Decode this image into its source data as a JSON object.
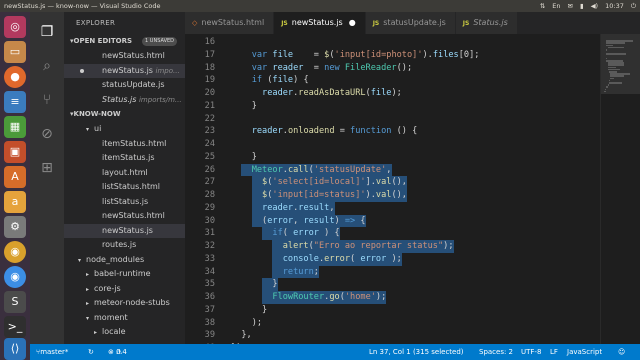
{
  "window": {
    "title": "newStatus.js — know-now — Visual Studio Code"
  },
  "tray": {
    "keyboard": "En",
    "time": "10:37"
  },
  "launcher": [
    "files-icon",
    "firefox-icon",
    "libreoffice-writer-icon",
    "libreoffice-calc-icon",
    "libreoffice-impress-icon",
    "software-center-icon",
    "amazon-icon",
    "settings-icon",
    "chrome-icon",
    "chrome-icon",
    "sublime-icon",
    "terminal-icon",
    "vscode-icon",
    "trash-icon"
  ],
  "sidebar": {
    "explorer_title": "EXPLORER",
    "open_editors_title": "OPEN EDITORS",
    "open_editors_badge": "1 UNSAVED",
    "open_editors": [
      {
        "name": "newStatus.html",
        "path": ""
      },
      {
        "name": "newStatus.js",
        "path": "impo..."
      },
      {
        "name": "statusUpdate.js",
        "path": ""
      },
      {
        "name": "Status.js",
        "path": "imports/m..."
      }
    ],
    "project_title": "KNOW-NOW",
    "tree": [
      {
        "name": "ui"
      },
      {
        "name": "itemStatus.html"
      },
      {
        "name": "itemStatus.js"
      },
      {
        "name": "layout.html"
      },
      {
        "name": "listStatus.html"
      },
      {
        "name": "listStatus.js"
      },
      {
        "name": "newStatus.html"
      },
      {
        "name": "newStatus.js"
      },
      {
        "name": "routes.js"
      },
      {
        "name": "node_modules"
      },
      {
        "name": "babel-runtime"
      },
      {
        "name": "core-js"
      },
      {
        "name": "meteor-node-stubs"
      },
      {
        "name": "moment"
      },
      {
        "name": "locale"
      }
    ]
  },
  "tabs": [
    {
      "name": "newStatus.html"
    },
    {
      "name": "newStatus.js"
    },
    {
      "name": "statusUpdate.js"
    },
    {
      "name": "Status.js"
    }
  ],
  "editor": {
    "lines": [
      {
        "n": "16",
        "sel": false,
        "t": []
      },
      {
        "n": "17",
        "sel": false,
        "t": [
          [
            "kw",
            "    var "
          ],
          [
            "vr",
            "file"
          ],
          [
            "tx",
            "    = "
          ],
          [
            "fn",
            "$"
          ],
          [
            "tx",
            "("
          ],
          [
            "str",
            "'input[id=photo]'"
          ],
          [
            "tx",
            ")."
          ],
          [
            "vr",
            "files"
          ],
          [
            "tx",
            "[0];"
          ]
        ]
      },
      {
        "n": "18",
        "sel": false,
        "t": [
          [
            "kw",
            "    var "
          ],
          [
            "vr",
            "reader"
          ],
          [
            "tx",
            "  = "
          ],
          [
            "kw",
            "new "
          ],
          [
            "cls",
            "FileReader"
          ],
          [
            "tx",
            "();"
          ]
        ]
      },
      {
        "n": "19",
        "sel": false,
        "t": [
          [
            "kw",
            "    if "
          ],
          [
            "tx",
            "("
          ],
          [
            "vr",
            "file"
          ],
          [
            "tx",
            ") {"
          ]
        ]
      },
      {
        "n": "20",
        "sel": false,
        "t": [
          [
            "vr",
            "      reader"
          ],
          [
            "tx",
            "."
          ],
          [
            "fn",
            "readAsDataURL"
          ],
          [
            "tx",
            "("
          ],
          [
            "vr",
            "file"
          ],
          [
            "tx",
            ");"
          ]
        ]
      },
      {
        "n": "21",
        "sel": false,
        "t": [
          [
            "tx",
            "    }"
          ]
        ]
      },
      {
        "n": "22",
        "sel": false,
        "t": []
      },
      {
        "n": "23",
        "sel": false,
        "t": [
          [
            "vr",
            "    reader"
          ],
          [
            "tx",
            "."
          ],
          [
            "fn",
            "onloadend"
          ],
          [
            "tx",
            " = "
          ],
          [
            "kw",
            "function "
          ],
          [
            "tx",
            "() {"
          ]
        ]
      },
      {
        "n": "24",
        "sel": false,
        "t": []
      },
      {
        "n": "25",
        "sel": false,
        "t": [
          [
            "tx",
            "    }"
          ]
        ]
      },
      {
        "n": "26",
        "sel": true,
        "t": [
          [
            "cls",
            "    Meteor"
          ],
          [
            "tx",
            "."
          ],
          [
            "fn",
            "call"
          ],
          [
            "tx",
            "("
          ],
          [
            "str",
            "'statusUpdate'"
          ],
          [
            "tx",
            ","
          ]
        ]
      },
      {
        "n": "27",
        "sel": true,
        "t": [
          [
            "fn",
            "      $"
          ],
          [
            "tx",
            "("
          ],
          [
            "str",
            "'select[id=local]'"
          ],
          [
            "tx",
            "]."
          ],
          [
            "fn",
            "val"
          ],
          [
            "tx",
            "(),"
          ]
        ]
      },
      {
        "n": "28",
        "sel": true,
        "t": [
          [
            "fn",
            "      $"
          ],
          [
            "tx",
            "("
          ],
          [
            "str",
            "'input[id=status]'"
          ],
          [
            "tx",
            ")."
          ],
          [
            "fn",
            "val"
          ],
          [
            "tx",
            "(),"
          ]
        ]
      },
      {
        "n": "29",
        "sel": true,
        "t": [
          [
            "vr",
            "      reader"
          ],
          [
            "tx",
            "."
          ],
          [
            "vr",
            "result"
          ],
          [
            "tx",
            ","
          ]
        ]
      },
      {
        "n": "30",
        "sel": true,
        "t": [
          [
            "tx",
            "      ("
          ],
          [
            "vr",
            "error"
          ],
          [
            "tx",
            ", "
          ],
          [
            "vr",
            "result"
          ],
          [
            "tx",
            ") "
          ],
          [
            "kw",
            "=>"
          ],
          [
            "tx",
            " {"
          ]
        ]
      },
      {
        "n": "31",
        "sel": true,
        "t": [
          [
            "kw",
            "        if"
          ],
          [
            "tx",
            "( "
          ],
          [
            "vr",
            "error"
          ],
          [
            "tx",
            " ) {"
          ]
        ]
      },
      {
        "n": "32",
        "sel": true,
        "t": [
          [
            "fn",
            "          alert"
          ],
          [
            "tx",
            "("
          ],
          [
            "str",
            "\"Erro ao reportar status\""
          ],
          [
            "tx",
            ");"
          ]
        ]
      },
      {
        "n": "33",
        "sel": true,
        "t": [
          [
            "vr",
            "          console"
          ],
          [
            "tx",
            "."
          ],
          [
            "fn",
            "error"
          ],
          [
            "tx",
            "( "
          ],
          [
            "vr",
            "error"
          ],
          [
            "tx",
            " );"
          ]
        ]
      },
      {
        "n": "34",
        "sel": true,
        "t": [
          [
            "kw",
            "          return"
          ],
          [
            "tx",
            ";"
          ]
        ]
      },
      {
        "n": "35",
        "sel": true,
        "t": [
          [
            "tx",
            "        }"
          ]
        ]
      },
      {
        "n": "36",
        "sel": true,
        "t": [
          [
            "cls",
            "        FlowRouter"
          ],
          [
            "tx",
            "."
          ],
          [
            "fn",
            "go"
          ],
          [
            "tx",
            "("
          ],
          [
            "str",
            "'home'"
          ],
          [
            "tx",
            ");"
          ]
        ]
      },
      {
        "n": "37",
        "sel": false,
        "t": [
          [
            "tx",
            "      }"
          ]
        ]
      },
      {
        "n": "38",
        "sel": false,
        "t": [
          [
            "tx",
            "    );"
          ]
        ]
      },
      {
        "n": "39",
        "sel": false,
        "t": [
          [
            "tx",
            "  },"
          ]
        ]
      },
      {
        "n": "40",
        "sel": false,
        "t": [
          [
            "tx",
            "});"
          ]
        ]
      }
    ]
  },
  "statusbar": {
    "branch": "master*",
    "errors": "0",
    "warnings": "4",
    "position": "Ln 37, Col 1 (315 selected)",
    "spaces": "Spaces: 2",
    "encoding": "UTF-8",
    "eol": "LF",
    "language": "JavaScript"
  }
}
